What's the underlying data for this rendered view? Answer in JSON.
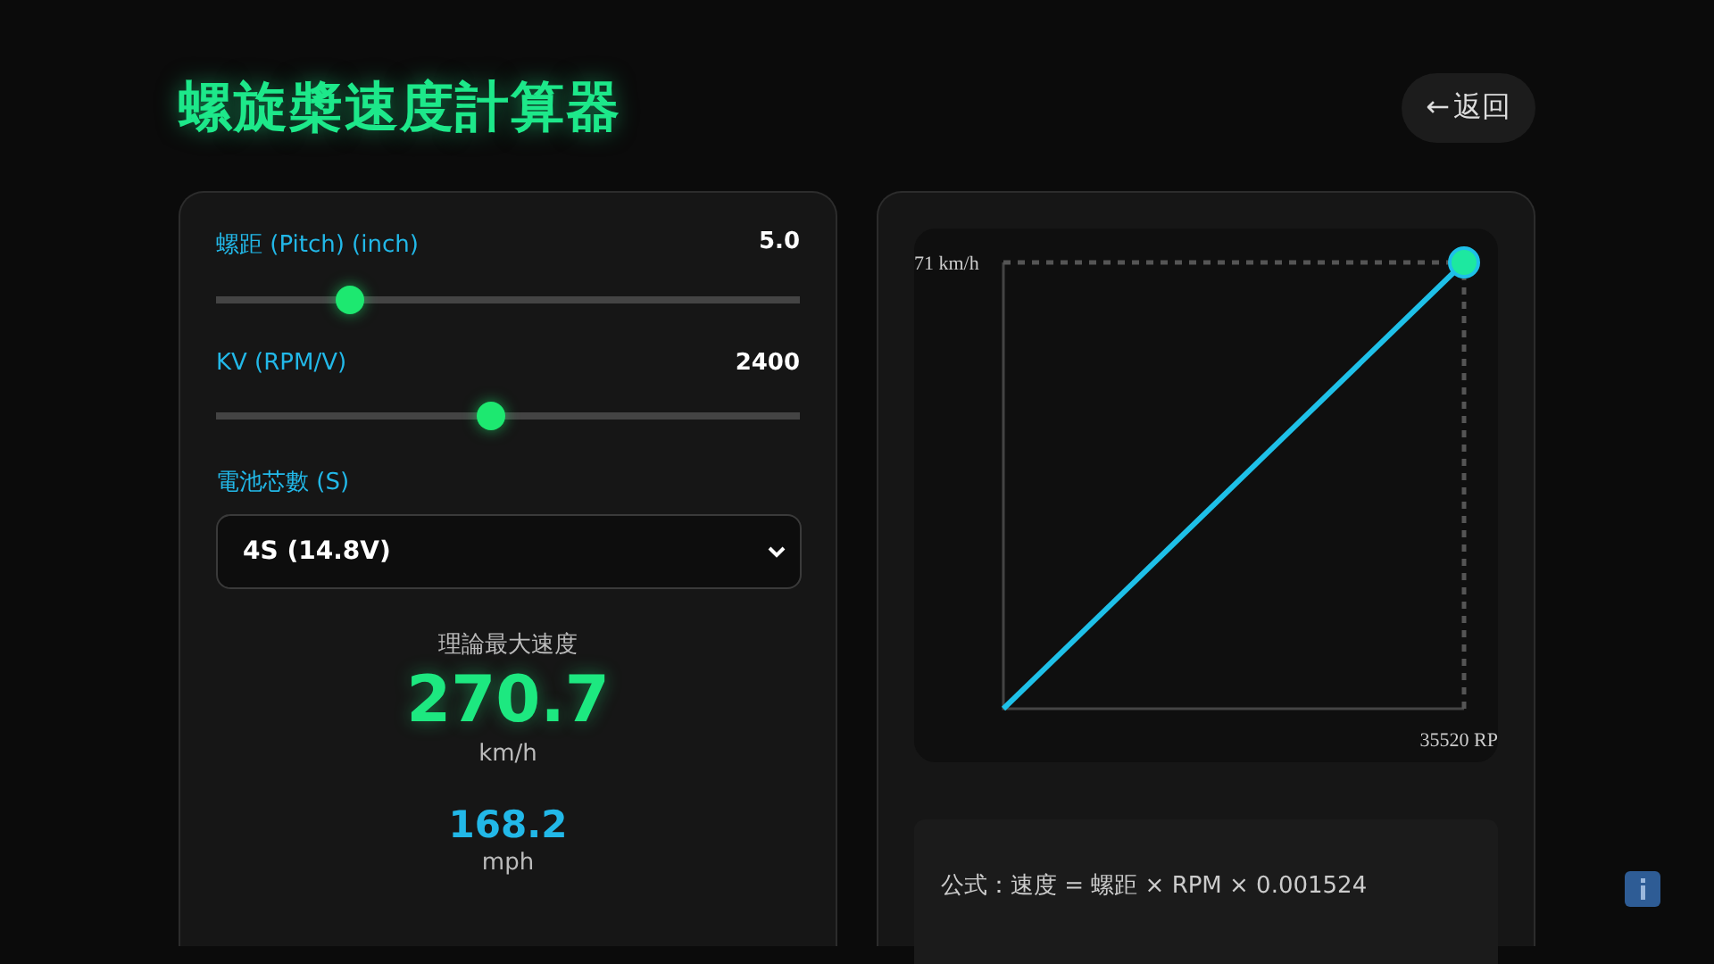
{
  "header": {
    "title": "螺旋槳速度計算器",
    "back_button": {
      "arrow": "←",
      "label": "返回"
    }
  },
  "sliders": [
    {
      "label": "螺距 (Pitch) (inch)",
      "reading": "5.0",
      "level": 0.23
    },
    {
      "label": "KV (RPM/V)",
      "reading": "2400",
      "level": 0.47
    }
  ],
  "battery": {
    "label": "電池芯數 (S)",
    "value": "4S (14.8V)"
  },
  "result": {
    "caption": "理論最大速度",
    "kmh": "270.7",
    "kmh_unit": "km/h",
    "mph": "168.2",
    "mph_unit": "mph"
  },
  "chart": {
    "y_label": "71 km/h",
    "x_label": "35520 RP"
  },
  "formula": "公式：速度 = 螺距 × RPM × 0.001524"
}
